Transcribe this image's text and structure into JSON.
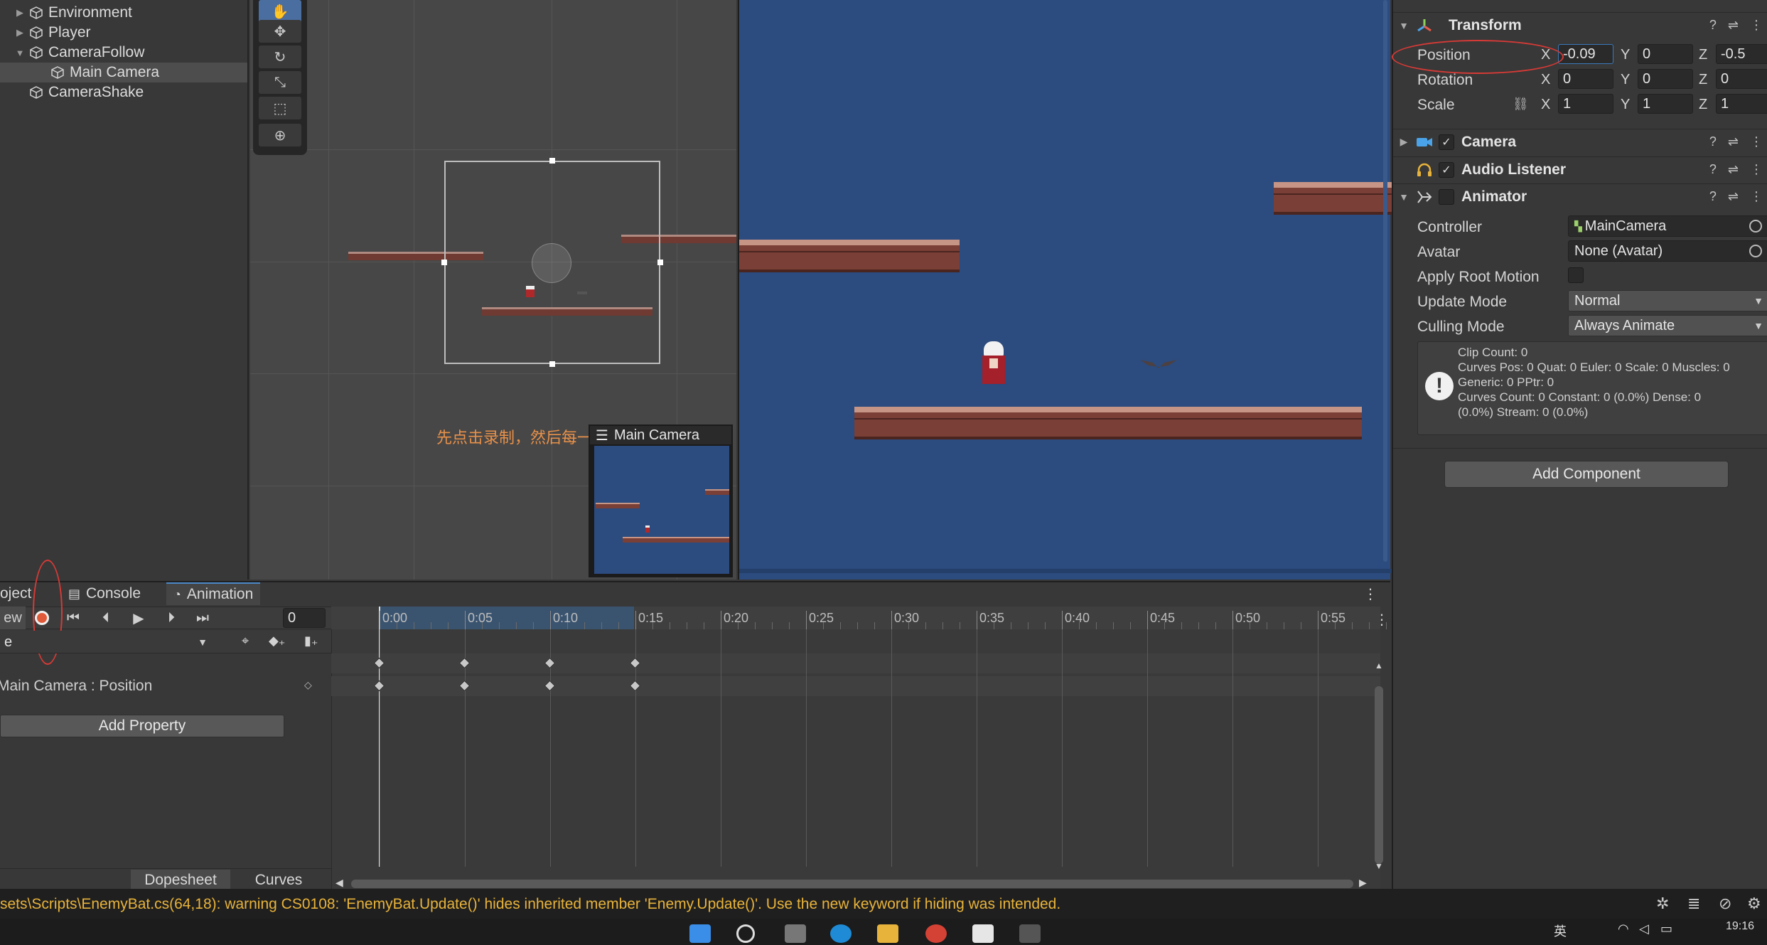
{
  "hierarchy": {
    "items": [
      {
        "label": "Environment",
        "expandable": true,
        "expanded": false
      },
      {
        "label": "Player",
        "expandable": true,
        "expanded": false
      },
      {
        "label": "CameraFollow",
        "expandable": true,
        "expanded": true
      },
      {
        "label": "Main Camera",
        "expandable": false,
        "selected": true
      },
      {
        "label": "CameraShake",
        "expandable": false
      }
    ]
  },
  "scene": {
    "annotation": "先点击录制，然后每一帧改一下相机位置",
    "camera_preview_title": "Main Camera",
    "tools": [
      "hand-tool",
      "move-tool",
      "rotate-tool",
      "scale-tool",
      "rect-tool",
      "transform-tool"
    ]
  },
  "inspector": {
    "transform": {
      "title": "Transform",
      "position_label": "Position",
      "rotation_label": "Rotation",
      "scale_label": "Scale",
      "axis_x": "X",
      "axis_y": "Y",
      "axis_z": "Z",
      "position": {
        "x": "-0.09",
        "y": "0",
        "z": "-0.5"
      },
      "rotation": {
        "x": "0",
        "y": "0",
        "z": "0"
      },
      "scale": {
        "x": "1",
        "y": "1",
        "z": "1"
      }
    },
    "camera": {
      "title": "Camera",
      "enabled": true
    },
    "audio_listener": {
      "title": "Audio Listener",
      "enabled": true
    },
    "animator": {
      "title": "Animator",
      "enabled": false,
      "controller_label": "Controller",
      "controller_value": "MainCamera",
      "avatar_label": "Avatar",
      "avatar_value": "None (Avatar)",
      "apply_root_motion_label": "Apply Root Motion",
      "apply_root_motion": false,
      "update_mode_label": "Update Mode",
      "update_mode_value": "Normal",
      "culling_mode_label": "Culling Mode",
      "culling_mode_value": "Always Animate",
      "info_lines": [
        "Clip Count: 0",
        "Curves Pos: 0 Quat: 0 Euler: 0 Scale: 0 Muscles: 0",
        "Generic: 0 PPtr: 0",
        "Curves Count: 0 Constant: 0 (0.0%) Dense: 0",
        "(0.0%) Stream: 0 (0.0%)"
      ]
    },
    "add_component_label": "Add Component"
  },
  "animation": {
    "tabs": [
      {
        "label": "oject",
        "active": false
      },
      {
        "label": "Console",
        "active": false
      },
      {
        "label": "Animation",
        "active": true
      }
    ],
    "preview_label": "ew",
    "frame_value": "0",
    "clip_dropdown": "e",
    "time_labels": [
      "0:00",
      "0:05",
      "0:10",
      "0:15",
      "0:20",
      "0:25",
      "0:30",
      "0:35",
      "0:40",
      "0:45",
      "0:50",
      "0:55"
    ],
    "property_label": "Main Camera : Position",
    "add_property_label": "Add Property",
    "dopesheet_label": "Dopesheet",
    "curves_label": "Curves",
    "keyframe_frames": [
      0,
      5,
      10,
      15
    ]
  },
  "status": {
    "message": "sets\\Scripts\\EnemyBat.cs(64,18): warning CS0108: 'EnemyBat.Update()' hides inherited member 'Enemy.Update()'. Use the new keyword if hiding was intended."
  },
  "taskbar": {
    "time": "19:16",
    "lang": "英"
  },
  "colors": {
    "accent": "#4b88c7",
    "record": "#e05a3a",
    "warning": "#e8b33a",
    "annotation": "#e8914a",
    "game_bg": "#2c4b7e",
    "highlight_oval": "#d73a36"
  }
}
